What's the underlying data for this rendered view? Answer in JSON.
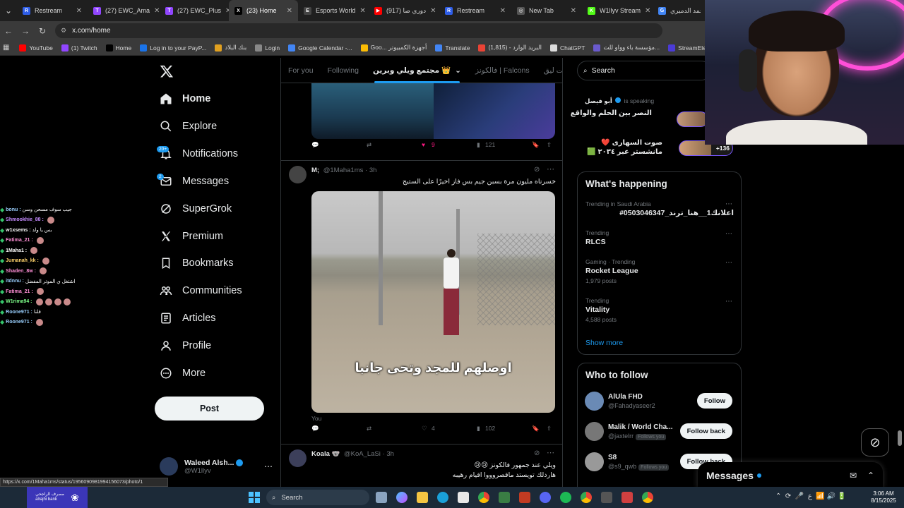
{
  "browser": {
    "tabs": [
      {
        "label": "Restream",
        "color": "#2f5ee8",
        "fav": "R"
      },
      {
        "label": "(27) EWC_Ama",
        "color": "#9146ff",
        "fav": "T"
      },
      {
        "label": "(27) EWC_Plus",
        "color": "#9146ff",
        "fav": "T"
      },
      {
        "label": "(23) Home",
        "color": "#000000",
        "fav": "X"
      },
      {
        "label": "Esports World",
        "color": "#444444",
        "fav": "E"
      },
      {
        "label": "(917) دوري صا",
        "color": "#ff0000",
        "fav": "▶"
      },
      {
        "label": "Restream",
        "color": "#2f5ee8",
        "fav": "R"
      },
      {
        "label": "New Tab",
        "color": "#555555",
        "fav": "◎"
      },
      {
        "label": "W1llyv Stream",
        "color": "#53fc18",
        "fav": "K"
      },
      {
        "label": "محمد الدميري",
        "color": "#4285f4",
        "fav": "G"
      }
    ],
    "url": "x.com/home",
    "bookmarks": [
      {
        "label": "YouTube",
        "color": "#ff0000"
      },
      {
        "label": "(1) Twitch",
        "color": "#9146ff"
      },
      {
        "label": "Home",
        "color": "#000000"
      },
      {
        "label": "Log in to your PayP...",
        "color": "#1a73e8"
      },
      {
        "label": "بنك البلاد",
        "color": "#e0a020"
      },
      {
        "label": "Login",
        "color": "#888888"
      },
      {
        "label": "Google Calendar -...",
        "color": "#4285f4"
      },
      {
        "label": "Goo... أجهزة الكمبيوتر",
        "color": "#fbbc04"
      },
      {
        "label": "Translate",
        "color": "#4285f4"
      },
      {
        "label": "البريد الوارد - (1,815)",
        "color": "#ea4335"
      },
      {
        "label": "ChatGPT",
        "color": "#dddddd"
      },
      {
        "label": "مؤسسة باء وواو للت...",
        "color": "#6a5acd"
      },
      {
        "label": "StreamElements",
        "color": "#4b3bd6"
      }
    ]
  },
  "chat": [
    {
      "user": "bonu :",
      "msg": "جيب سوف مسحن وسن",
      "color": "#9ad0ff",
      "emotes": 0
    },
    {
      "user": "Shmookhie_88 :",
      "msg": "",
      "color": "#c58bff",
      "emotes": 1
    },
    {
      "user": "w1xsems :",
      "msg": "بس يا ولد",
      "color": "#ffffff",
      "emotes": 0
    },
    {
      "user": "Fatima_21 :",
      "msg": "",
      "color": "#ff8fd6",
      "emotes": 1
    },
    {
      "user": "1Maha1 :",
      "msg": "",
      "color": "#ffffff",
      "emotes": 1
    },
    {
      "user": "Jumanah_kk :",
      "msg": "",
      "color": "#ffd36b",
      "emotes": 1
    },
    {
      "user": "Shaden_8w :",
      "msg": "",
      "color": "#ff8fd6",
      "emotes": 1
    },
    {
      "user": "itdnnu :",
      "msg": "اشتغل ي الموتر المفضل",
      "color": "#9ad0ff",
      "emotes": 0
    },
    {
      "user": "Fatima_21 :",
      "msg": "",
      "color": "#ff8fd6",
      "emotes": 1
    },
    {
      "user": "W1rima94 :",
      "msg": "",
      "color": "#7dff8a",
      "emotes": 4
    },
    {
      "user": "Roone971 :",
      "msg": "قلنا",
      "color": "#9ad0ff",
      "emotes": 0
    },
    {
      "user": "Roone971 :",
      "msg": "",
      "color": "#9ad0ff",
      "emotes": 1
    }
  ],
  "nav": {
    "items": [
      {
        "label": "Home",
        "icon": "home-icon"
      },
      {
        "label": "Explore",
        "icon": "search-icon"
      },
      {
        "label": "Notifications",
        "icon": "bell-icon",
        "badge": "20+"
      },
      {
        "label": "Messages",
        "icon": "mail-icon",
        "badge": "2"
      },
      {
        "label": "SuperGrok",
        "icon": "grok-icon"
      },
      {
        "label": "Premium",
        "icon": "x-logo-icon"
      },
      {
        "label": "Bookmarks",
        "icon": "bookmark-icon"
      },
      {
        "label": "Communities",
        "icon": "communities-icon"
      },
      {
        "label": "Articles",
        "icon": "article-icon"
      },
      {
        "label": "Profile",
        "icon": "person-icon"
      },
      {
        "label": "More",
        "icon": "more-circle-icon"
      }
    ],
    "post_label": "Post"
  },
  "account": {
    "name": "Waleed Alsh...",
    "handle": "@W1llyv"
  },
  "feed_tabs": [
    "For you",
    "Following",
    "مجتمع ويلي وبرين 👑",
    "فالكونز | Falcons",
    "روكيت ليق"
  ],
  "posts": {
    "prev": {
      "likes": "9",
      "views": "121"
    },
    "main": {
      "author": "M;",
      "handle": "@1Maha1ms",
      "time": "3h",
      "text": "خسرناه مليون مرة بسبن جيم بس فاز اخيرًا على الستيج",
      "caption": "اوصلهم للمجد وتحى جانبا",
      "media_caption": "You",
      "replies": "",
      "reposts": "",
      "likes": "4",
      "views": "102"
    },
    "next": {
      "author": "Koala 🐨",
      "handle": "@KoA_LaSi",
      "time": "3h",
      "line1": "ويلي عند جمهور فالكونز 😢😢",
      "line2": "هاردلك تويستد ماقصروووا اقيام رهيبه"
    }
  },
  "status_url": "https://x.com/1Maha1ms/status/1956090981994156073/photo/1",
  "search": {
    "placeholder": "Search"
  },
  "spaces": [
    {
      "host": "أبو فيصل",
      "status": "is speaking",
      "title": "النصر بين الحلم والواقع"
    },
    {
      "title": "صوت السهارى ❤️ مانشستر عبر ٢٠٣٤ 🟩",
      "extra": "+136"
    }
  ],
  "happening": {
    "title": "What's happening",
    "trends": [
      {
        "meta": "Trending in Saudi Arabia",
        "name": "#اعلانك1__هنا_ترند_0503046347",
        "count": ""
      },
      {
        "meta": "Trending",
        "name": "RLCS",
        "count": ""
      },
      {
        "meta": "Gaming · Trending",
        "name": "Rocket League",
        "count": "1,979 posts"
      },
      {
        "meta": "Trending",
        "name": "Vitality",
        "count": "4,588 posts"
      }
    ],
    "show_more": "Show more"
  },
  "who_to_follow": {
    "title": "Who to follow",
    "users": [
      {
        "name": "AlUla FHD",
        "handle": "@Fahadyaseer2",
        "button": "Follow",
        "follows_you": false,
        "color": "#6a8ab5"
      },
      {
        "name": "Malik / World Cha...",
        "handle": "@jaxtelrr",
        "button": "Follow back",
        "follows_you": true,
        "color": "#777777"
      },
      {
        "name": "S8",
        "handle": "@s9_qwb",
        "button": "Follow back",
        "follows_you": true,
        "color": "#999999"
      }
    ],
    "follows_you_label": "Follows you"
  },
  "messages_drawer": {
    "title": "Messages"
  },
  "taskbar": {
    "search": "Search",
    "time": "3:06 AM",
    "date": "8/15/2025",
    "bank": "مصرف الراجحي alrajhi bank"
  },
  "colors": {
    "accent": "#1d9bf0",
    "like": "#f91880",
    "bg": "#000000",
    "border": "#2f3336"
  }
}
